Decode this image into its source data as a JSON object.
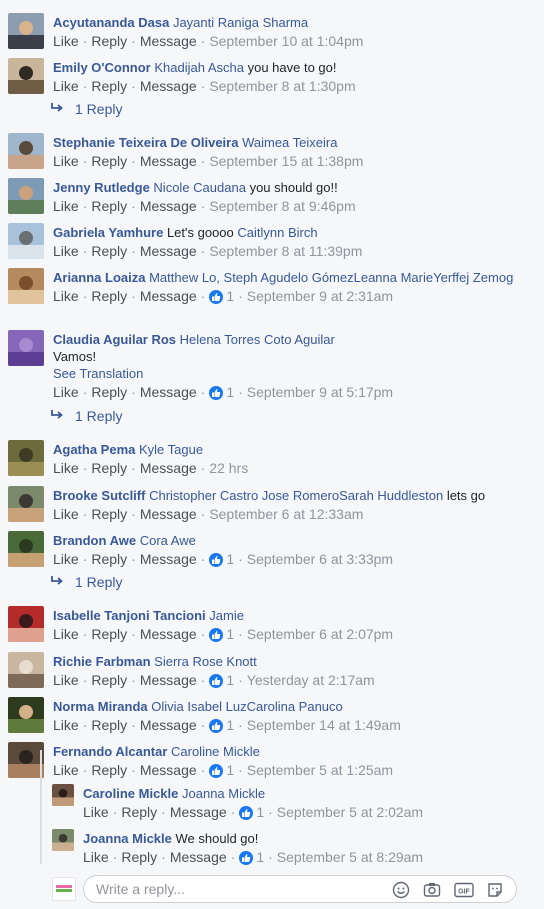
{
  "actions": {
    "like": "Like",
    "reply": "Reply",
    "message": "Message"
  },
  "colors": {
    "link": "#385898",
    "meta": "#90949c",
    "reaction": "#1877f2"
  },
  "comments": [
    {
      "name": "Acyutananda Dasa",
      "tags": "Jayanti Raniga Sharma",
      "text": "",
      "reactions": "",
      "time": "September 10 at 1:04pm",
      "avatar": [
        "#8d9db0",
        "#3a3f4a",
        "#d8b38c"
      ]
    },
    {
      "name": "Emily O'Connor",
      "tags": "Khadijah Ascha",
      "text": "you have to go!",
      "reactions": "",
      "time": "September 8 at 1:30pm",
      "avatar": [
        "#c9b59a",
        "#6f5d45",
        "#2f2a24"
      ],
      "reply_link": "1 Reply"
    },
    {
      "name": "Stephanie Teixeira De Oliveira",
      "tags": "Waimea Teixeira",
      "text": "",
      "reactions": "",
      "time": "September 15 at 1:38pm",
      "avatar": [
        "#9fb6cc",
        "#c8a58a",
        "#5a4a3c"
      ]
    },
    {
      "name": "Jenny Rutledge",
      "tags": "Nicole Caudana",
      "text": "you should go!!",
      "reactions": "",
      "time": "September 8 at 9:46pm",
      "avatar": [
        "#7d9bb4",
        "#5e7f59",
        "#c9a27c"
      ]
    },
    {
      "name": "Gabriela Yamhure",
      "tags": "",
      "text": "Let's goooo",
      "tags_after": "Caitlynn Birch",
      "reactions": "",
      "time": "September 8 at 11:39pm",
      "avatar": [
        "#a8c2dc",
        "#d9e3ec",
        "#6a6f73"
      ]
    },
    {
      "name": "Arianna Loaiza",
      "tags": "Matthew Lo, Steph Agudelo GómezLeanna MarieYerffej Zemog",
      "text": "",
      "reactions": "1",
      "time": "September 9 at 2:31am",
      "avatar": [
        "#b58a5e",
        "#e0c39a",
        "#7b4e2c"
      ]
    },
    {
      "name": "Claudia Aguilar Ros",
      "tags": "Helena Torres Coto Aguilar",
      "text": "Vamos!",
      "see_translation": "See Translation",
      "reactions": "1",
      "time": "September 9 at 5:17pm",
      "avatar": [
        "#8566b8",
        "#5c3f95",
        "#a78ad0"
      ],
      "reply_link": "1 Reply"
    },
    {
      "name": "Agatha Pema",
      "tags": "Kyle Tague",
      "text": "",
      "reactions": "",
      "time": "22 hrs",
      "avatar": [
        "#6d6a3c",
        "#9b8f55",
        "#3e3b25"
      ]
    },
    {
      "name": "Brooke Sutcliff",
      "tags": "Christopher Castro Jose RomeroSarah Huddleston",
      "text": "lets go",
      "reactions": "",
      "time": "September 6 at 12:33am",
      "avatar": [
        "#7a8a6a",
        "#c7a27a",
        "#3d3a35"
      ]
    },
    {
      "name": "Brandon Awe",
      "tags": "Cora Awe",
      "text": "",
      "reactions": "1",
      "time": "September 6 at 3:33pm",
      "avatar": [
        "#4a6a3a",
        "#c4a072",
        "#2b3a1f"
      ],
      "reply_link": "1 Reply"
    },
    {
      "name": "Isabelle Tanjoni Tancioni",
      "tags": "Jamie",
      "text": "",
      "reactions": "1",
      "time": "September 6 at 2:07pm",
      "avatar": [
        "#b52a2a",
        "#e0a090",
        "#3a1a1a"
      ]
    },
    {
      "name": "Richie Farbman",
      "tags": "Sierra Rose Knott",
      "text": "",
      "reactions": "1",
      "time": "Yesterday at 2:17am",
      "avatar": [
        "#c8b6a0",
        "#7d6a58",
        "#e6dccf"
      ]
    },
    {
      "name": "Norma Miranda",
      "tags": "Olivia Isabel LuzCarolina Panuco",
      "text": "",
      "reactions": "1",
      "time": "September 14 at 1:49am",
      "avatar": [
        "#2c3a1e",
        "#5f7a3a",
        "#d4b08a"
      ]
    },
    {
      "name": "Fernando Alcantar",
      "tags": "Caroline Mickle",
      "text": "",
      "reactions": "1",
      "time": "September 5 at 1:25am",
      "avatar": [
        "#5a4a3a",
        "#a88060",
        "#2a241e"
      ]
    }
  ],
  "replies": [
    {
      "name": "Caroline Mickle",
      "tags": "Joanna Mickle",
      "text": "",
      "reactions": "1",
      "time": "September 5 at 2:02am",
      "avatar": [
        "#6a5040",
        "#c09a78",
        "#2a1f18"
      ]
    },
    {
      "name": "Joanna Mickle",
      "tags": "",
      "text": "We should go!",
      "reactions": "1",
      "time": "September 5 at 8:29am",
      "avatar": [
        "#7a8a6a",
        "#c8b090",
        "#3a3a30"
      ]
    }
  ],
  "composer": {
    "placeholder": "Write a reply...",
    "icons": [
      "emoji-icon",
      "camera-icon",
      "gif-icon",
      "sticker-icon"
    ],
    "gif_label": "GIF"
  }
}
